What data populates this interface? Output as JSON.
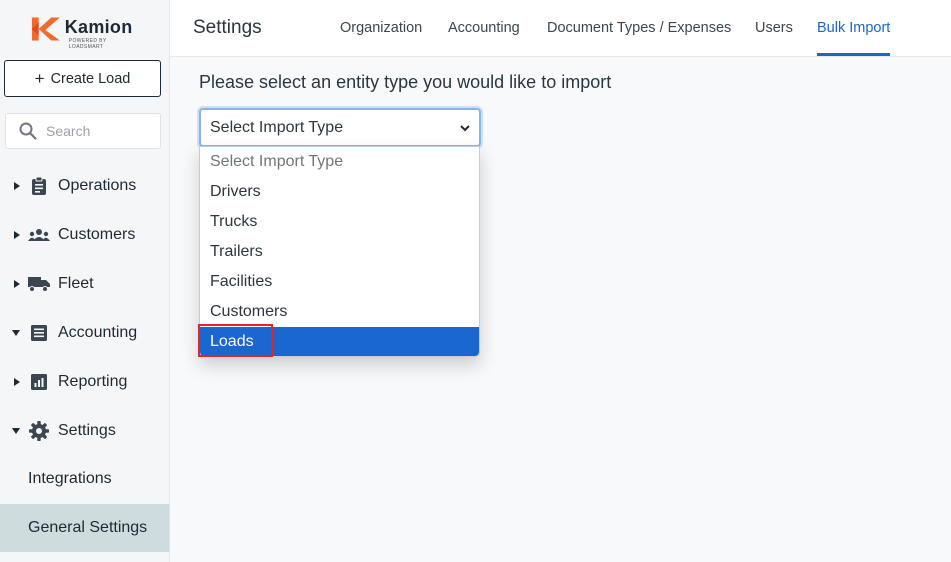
{
  "brand": {
    "name": "Kamion",
    "tagline": "POWERED BY LOADSMART",
    "accent": "#f26b2e"
  },
  "sidebar": {
    "create_label": "Create Load",
    "search_placeholder": "Search",
    "items": [
      {
        "label": "Operations",
        "icon": "clipboard-icon",
        "expanded": false
      },
      {
        "label": "Customers",
        "icon": "people-icon",
        "expanded": false
      },
      {
        "label": "Fleet",
        "icon": "truck-icon",
        "expanded": false
      },
      {
        "label": "Accounting",
        "icon": "ledger-icon",
        "expanded": true
      },
      {
        "label": "Reporting",
        "icon": "report-icon",
        "expanded": false
      },
      {
        "label": "Settings",
        "icon": "gear-icon",
        "expanded": true
      }
    ],
    "sub_items": [
      {
        "label": "Integrations",
        "active": false
      },
      {
        "label": "General Settings",
        "active": true
      }
    ]
  },
  "header": {
    "title": "Settings",
    "tabs": [
      {
        "label": "Organization",
        "active": false
      },
      {
        "label": "Accounting",
        "active": false
      },
      {
        "label": "Document Types / Expenses",
        "active": false
      },
      {
        "label": "Users",
        "active": false
      },
      {
        "label": "Bulk Import",
        "active": true
      }
    ]
  },
  "main": {
    "prompt": "Please select an entity type you would like to import",
    "select": {
      "value": "Select Import Type",
      "options": [
        "Select Import Type",
        "Drivers",
        "Trucks",
        "Trailers",
        "Facilities",
        "Customers",
        "Loads"
      ],
      "highlighted": "Loads"
    }
  },
  "colors": {
    "tab_active": "#1a67c4",
    "option_selected_bg": "#1a67d1",
    "nav_active_bg": "#cfdcde",
    "highlight_border": "#e0262b"
  }
}
